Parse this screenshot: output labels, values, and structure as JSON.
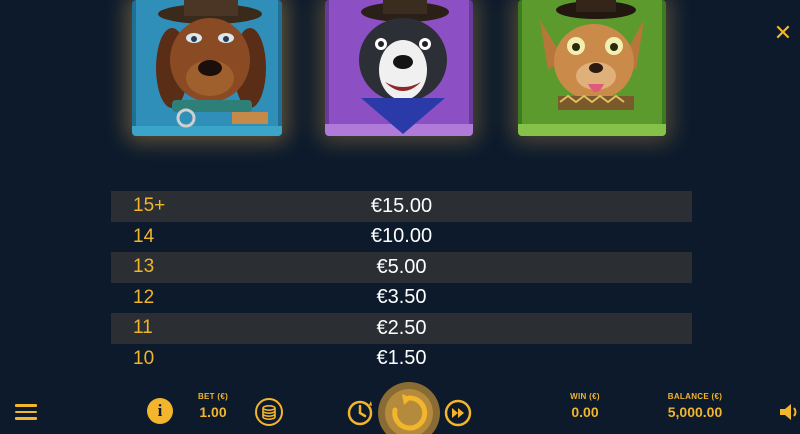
{
  "symbols": [
    {
      "name": "dachshund-sheriff-symbol",
      "frame_color": "#3aa5c8"
    },
    {
      "name": "boston-terrier-bandana-symbol",
      "frame_color": "#9a57c9"
    },
    {
      "name": "chihuahua-bandit-symbol",
      "frame_color": "#6aa82a"
    }
  ],
  "paytable": {
    "rows": [
      {
        "count": "15+",
        "payout": "€15.00"
      },
      {
        "count": "14",
        "payout": "€10.00"
      },
      {
        "count": "13",
        "payout": "€5.00"
      },
      {
        "count": "12",
        "payout": "€3.50"
      },
      {
        "count": "11",
        "payout": "€2.50"
      },
      {
        "count": "10",
        "payout": "€1.50"
      }
    ]
  },
  "close": {
    "icon": "close-icon",
    "glyph": "✕"
  },
  "bottom_bar": {
    "info_glyph": "i",
    "bet_label": "BET (€)",
    "bet_value": "1.00",
    "win_label": "WIN (€)",
    "win_value": "0.00",
    "balance_label": "BALANCE (€)",
    "balance_value": "5,000.00"
  },
  "colors": {
    "accent": "#f2b52c",
    "background": "#0c1a2c",
    "row_shade": "#2b2e33"
  }
}
